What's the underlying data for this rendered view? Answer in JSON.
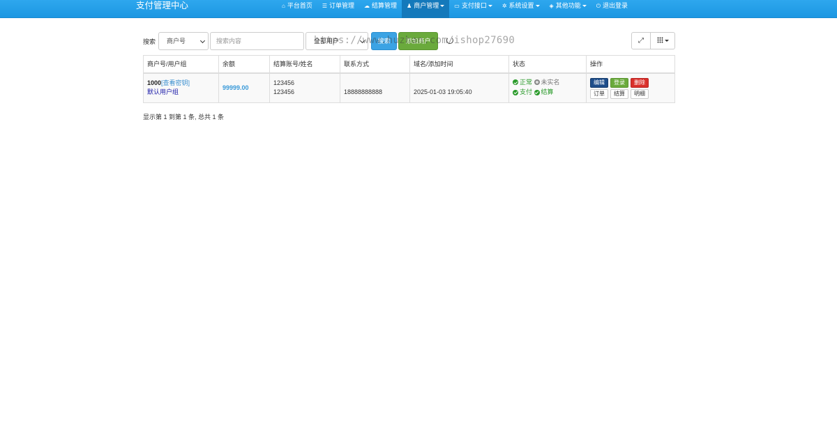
{
  "brand": "支付管理中心",
  "nav": [
    {
      "icon": "home-icon",
      "glyph": "⌂",
      "label": "平台首页",
      "active": false,
      "dropdown": false
    },
    {
      "icon": "list-icon",
      "glyph": "☰",
      "label": "订单管理",
      "active": false,
      "dropdown": false
    },
    {
      "icon": "cloud-icon",
      "glyph": "☁",
      "label": "结算管理",
      "active": false,
      "dropdown": false
    },
    {
      "icon": "user-icon",
      "glyph": "♟",
      "label": "商户管理",
      "active": true,
      "dropdown": true
    },
    {
      "icon": "card-icon",
      "glyph": "▭",
      "label": "支付接口",
      "active": false,
      "dropdown": true
    },
    {
      "icon": "gear-icon",
      "glyph": "✲",
      "label": "系统设置",
      "active": false,
      "dropdown": true
    },
    {
      "icon": "cube-icon",
      "glyph": "◈",
      "label": "其他功能",
      "active": false,
      "dropdown": true
    },
    {
      "icon": "power-icon",
      "glyph": "⏻",
      "label": "退出登录",
      "active": false,
      "dropdown": false
    }
  ],
  "toolbar": {
    "search_label": "搜索",
    "field_select": "商户号",
    "search_placeholder": "搜索内容",
    "group_select": "全部用户",
    "search_button": "搜索",
    "add_button": "添加商户"
  },
  "watermark": "https://www.huzhan.com/ishop27690",
  "table": {
    "headers": [
      "商户号/用户组",
      "余额",
      "结算账号/姓名",
      "联系方式",
      "域名/添加时间",
      "状态",
      "操作"
    ],
    "rows": [
      {
        "merchant_id": "1000",
        "view_key": "[查看密钥]",
        "group": "默认用户组",
        "balance": "99999.00",
        "account": "123456",
        "name": "123456",
        "contact": "18888888888",
        "added_time": "2025-01-03 19:05:40",
        "status_normal": "正常",
        "status_unverified": "未实名",
        "status_pay": "支付",
        "status_settle": "结算",
        "op_edit": "编辑",
        "op_login": "登录",
        "op_delete": "删除",
        "op_orders": "订单",
        "op_settle": "结算",
        "op_detail": "明细"
      }
    ]
  },
  "pager_info": "显示第 1 到第 1 条, 总共 1 条"
}
